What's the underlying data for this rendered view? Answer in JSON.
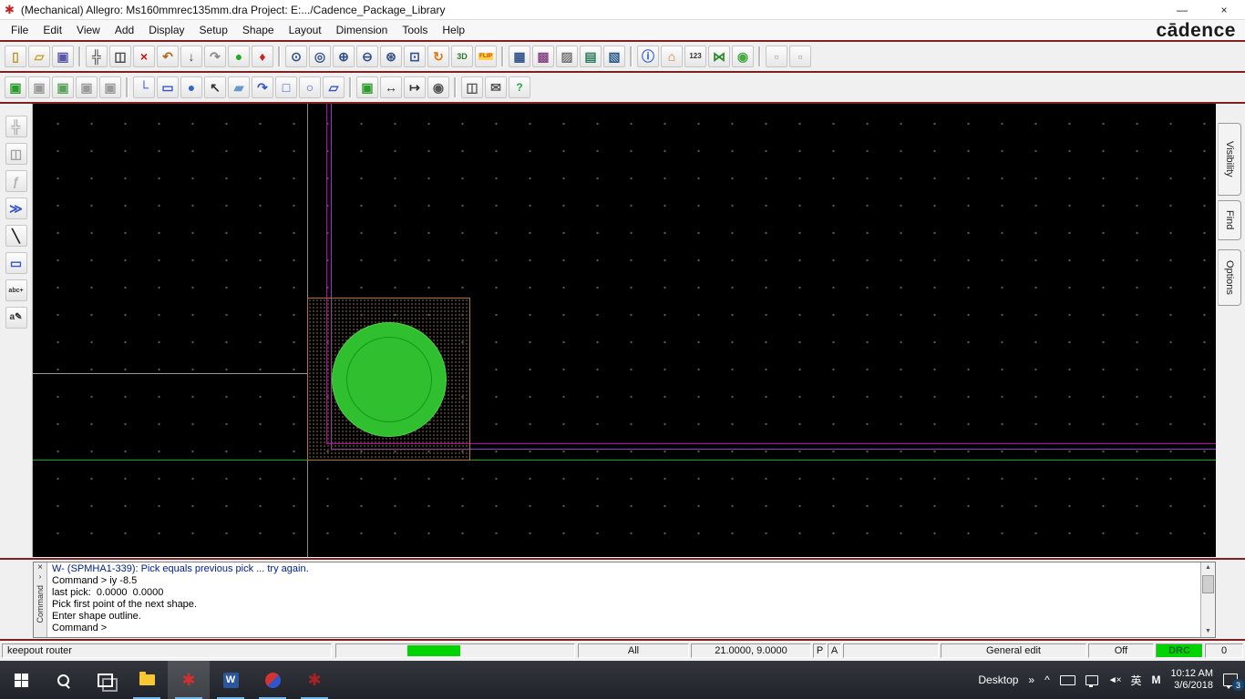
{
  "colors": {
    "accent_maroon": "#7c2020",
    "canvas_background": "#000000",
    "pad_fill_green": "#2fbf2f",
    "pad_ring_green": "#159915",
    "pad_boundary_orange": "#b8732a",
    "keepout_magenta": "#c000c0",
    "keepout_purple": "#9933cc",
    "route_line_green": "#00b400",
    "drc_indicator_green": "#00d400"
  },
  "title_bar": {
    "title": "(Mechanical) Allegro: Ms160mmrec135mm.dra  Project: E:.../Cadence_Package_Library",
    "minimize_glyph": "—",
    "close_glyph": "×"
  },
  "menu_bar": {
    "items": [
      "File",
      "Edit",
      "View",
      "Add",
      "Display",
      "Setup",
      "Shape",
      "Layout",
      "Dimension",
      "Tools",
      "Help"
    ],
    "brand": "cādence"
  },
  "toolbar_main": [
    {
      "name": "new-file-icon",
      "glyph": "▯",
      "color": "#b8962e"
    },
    {
      "name": "open-folder-icon",
      "glyph": "▱",
      "color": "#c8a030"
    },
    {
      "name": "save-icon",
      "glyph": "▣",
      "color": "#5858a8"
    },
    {
      "sep": true
    },
    {
      "name": "move-icon",
      "glyph": "╬",
      "color": "#444444"
    },
    {
      "name": "copy-icon",
      "glyph": "◫",
      "color": "#444444"
    },
    {
      "name": "delete-icon",
      "glyph": "×",
      "color": "#cc1111"
    },
    {
      "name": "undo-icon",
      "glyph": "↶",
      "color": "#b06a1e"
    },
    {
      "name": "import-icon",
      "glyph": "↓",
      "color": "#444444"
    },
    {
      "name": "redo-icon",
      "glyph": "↷",
      "color": "#888888"
    },
    {
      "name": "highlight-icon",
      "glyph": "●",
      "color": "#22aa22"
    },
    {
      "name": "pin-icon",
      "glyph": "♦",
      "color": "#cc2222"
    },
    {
      "sep": true
    },
    {
      "name": "zoom-points-icon",
      "glyph": "⊙",
      "color": "#33538a"
    },
    {
      "name": "zoom-fit-icon",
      "glyph": "◎",
      "color": "#33538a"
    },
    {
      "name": "zoom-in-icon",
      "glyph": "⊕",
      "color": "#33538a"
    },
    {
      "name": "zoom-out-icon",
      "glyph": "⊖",
      "color": "#33538a"
    },
    {
      "name": "zoom-world-icon",
      "glyph": "⊛",
      "color": "#33538a"
    },
    {
      "name": "zoom-previous-icon",
      "glyph": "⊡",
      "color": "#33538a"
    },
    {
      "name": "redraw-icon",
      "glyph": "↻",
      "color": "#e07818"
    },
    {
      "name": "view-3d-icon",
      "glyph": "3D",
      "color": "#2a7a2a",
      "fs": "9px"
    },
    {
      "name": "flip-design-icon",
      "glyph": "FLIP",
      "color": "#d04000",
      "fs": "6.5px",
      "bg": "#ffd24d"
    },
    {
      "sep": true
    },
    {
      "name": "grid-toggle-icon",
      "glyph": "▦",
      "color": "#33538a"
    },
    {
      "name": "color-192-icon",
      "glyph": "▩",
      "color": "#8a4a8a"
    },
    {
      "name": "shadow-mode-icon",
      "glyph": "▨",
      "color": "#777777"
    },
    {
      "name": "layer-groups-icon",
      "glyph": "▤",
      "color": "#2a7a5a"
    },
    {
      "name": "color-dialog-icon",
      "glyph": "▧",
      "color": "#2a5a8a"
    },
    {
      "sep": true
    },
    {
      "name": "info-icon",
      "glyph": "ⓘ",
      "color": "#2255cc"
    },
    {
      "name": "properties-icon",
      "glyph": "⌂",
      "color": "#cc7722"
    },
    {
      "name": "measure-icon",
      "glyph": "123",
      "color": "#333333",
      "fs": "8px"
    },
    {
      "name": "waive-drc-icon",
      "glyph": "⋈",
      "color": "#2a8a2a"
    },
    {
      "name": "drc-update-icon",
      "glyph": "◉",
      "color": "#44aa44"
    },
    {
      "sep": true
    },
    {
      "name": "cross-section-icon",
      "glyph": "▫",
      "color": "#999999"
    },
    {
      "name": "reports-icon",
      "glyph": "▫",
      "color": "#999999"
    }
  ],
  "toolbar_draw": [
    {
      "name": "symbol-mode-icon",
      "glyph": "▣",
      "color": "#2a9a2a"
    },
    {
      "name": "board-mode-icon",
      "glyph": "▣",
      "color": "#9a9a9a"
    },
    {
      "name": "padstack-mode-icon",
      "glyph": "▣",
      "color": "#5aa05a"
    },
    {
      "name": "module-mode-icon",
      "glyph": "▣",
      "color": "#9a9a9a"
    },
    {
      "name": "drawing-mode-icon",
      "glyph": "▣",
      "color": "#9a9a9a"
    },
    {
      "sep": true
    },
    {
      "name": "add-connect-icon",
      "glyph": "└",
      "color": "#3355cc"
    },
    {
      "name": "add-rect-icon",
      "glyph": "▭",
      "color": "#3355cc"
    },
    {
      "name": "add-circle-icon",
      "glyph": "●",
      "color": "#3366cc"
    },
    {
      "name": "select-cursor-icon",
      "glyph": "↖",
      "color": "#333333"
    },
    {
      "name": "shape-polygon-icon",
      "glyph": "▰",
      "color": "#6699cc"
    },
    {
      "name": "spin-icon",
      "glyph": "↷",
      "color": "#3355cc"
    },
    {
      "name": "shape-rect-icon",
      "glyph": "□",
      "color": "#3355cc"
    },
    {
      "name": "shape-circle-icon",
      "glyph": "○",
      "color": "#3355cc"
    },
    {
      "name": "shape-select-icon",
      "glyph": "▱",
      "color": "#3355cc"
    },
    {
      "sep": true
    },
    {
      "name": "place-symbol-icon",
      "glyph": "▣",
      "color": "#2a9a2a"
    },
    {
      "name": "dimension-linear-icon",
      "glyph": "↔",
      "color": "#333333"
    },
    {
      "name": "dimension-leader-icon",
      "glyph": "↦",
      "color": "#333333"
    },
    {
      "name": "snapshot-camera-icon",
      "glyph": "◉",
      "color": "#555555"
    },
    {
      "sep": true
    },
    {
      "name": "copy-view-icon",
      "glyph": "◫",
      "color": "#555555"
    },
    {
      "name": "mail-export-icon",
      "glyph": "✉",
      "color": "#555555"
    },
    {
      "name": "help-icon",
      "glyph": "?",
      "color": "#22aa44",
      "fs": "12px"
    }
  ],
  "toolbar_left": [
    {
      "name": "move-vertex-icon",
      "glyph": "╬",
      "color": "#a0a0a0"
    },
    {
      "name": "copy-stamp-icon",
      "glyph": "◫",
      "color": "#a0a0a0"
    },
    {
      "name": "fillet-icon",
      "glyph": "ƒ",
      "color": "#b5b5b5"
    },
    {
      "name": "slide-icon",
      "glyph": "≫",
      "color": "#3355cc"
    },
    {
      "name": "add-line-icon",
      "glyph": "╲",
      "color": "#222222"
    },
    {
      "name": "shape-rect-icon",
      "glyph": "▭",
      "color": "#3355cc"
    },
    {
      "name": "add-text-icon",
      "glyph": "abc+",
      "color": "#333333",
      "fs": "7px"
    },
    {
      "name": "edit-text-icon",
      "glyph": "a✎",
      "color": "#333333",
      "fs": "10px"
    }
  ],
  "right_panel": {
    "tabs": [
      {
        "label": "Visibility"
      },
      {
        "label": "Find"
      },
      {
        "label": "Options"
      }
    ]
  },
  "console": {
    "close_glyph": "×",
    "expand_glyph": "›",
    "tab_label": "Command",
    "scroll_up_glyph": "▲",
    "scroll_down_glyph": "▼",
    "lines": [
      {
        "text": "W- (SPMHA1-339): Pick equals previous pick ... try again.",
        "color": "#00208a"
      },
      {
        "text": "Command > iy -8.5",
        "color": "#000000"
      },
      {
        "text": "last pick:  0.0000  0.0000",
        "color": "#000000"
      },
      {
        "text": "Pick first point of the next shape.",
        "color": "#000000"
      },
      {
        "text": "Enter shape outline.",
        "color": "#000000"
      },
      {
        "text": "Command > ",
        "color": "#000000"
      }
    ]
  },
  "status_bar": {
    "mode": "keepout router",
    "filter": "All",
    "coordinates": "21.0000, 9.0000",
    "pick_button": "P",
    "angle_button": "A",
    "edit_mode": "General edit",
    "ortho": "Off",
    "drc_label": "DRC",
    "drc_count": "0"
  },
  "taskbar": {
    "desktop_label": "Desktop",
    "overflow_glyph": "»",
    "hidden_icons_glyph": "^",
    "ime_label": "英",
    "ime_mode_label": "M",
    "time": "10:12 AM",
    "date": "3/6/2018",
    "notification_count": "3",
    "word_label": "W"
  }
}
